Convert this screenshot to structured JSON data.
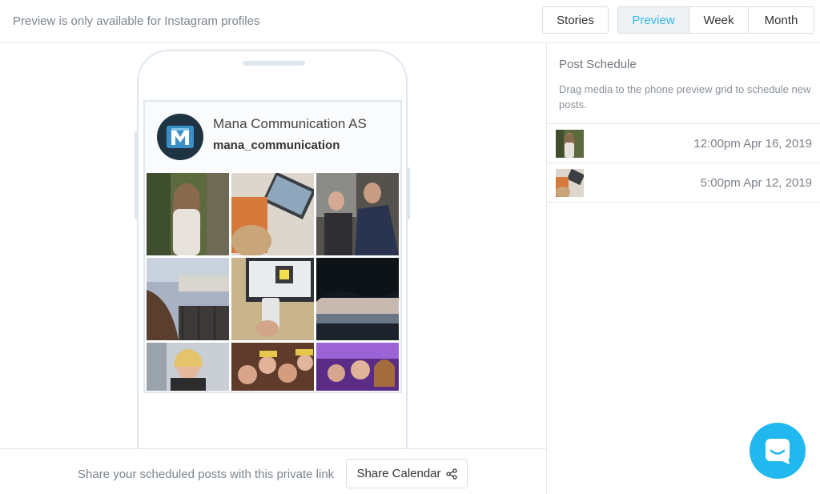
{
  "header": {
    "notice": "Preview is only available for Instagram profiles",
    "stories_label": "Stories",
    "views": [
      "Preview",
      "Week",
      "Month"
    ]
  },
  "profile": {
    "name": "Mana Communication AS",
    "handle": "mana_communication"
  },
  "footer": {
    "share_text": "Share your scheduled posts with this private link",
    "share_button": "Share Calendar"
  },
  "panel": {
    "title": "Post Schedule",
    "description": "Drag media to the phone preview grid to schedule new posts.",
    "items": [
      {
        "time": "12:00pm Apr 16, 2019"
      },
      {
        "time": "5:00pm Apr 12, 2019"
      }
    ]
  },
  "colors": {
    "accent": "#35b5ef",
    "chat": "#20b8ef",
    "border": "#e3e7eb"
  }
}
